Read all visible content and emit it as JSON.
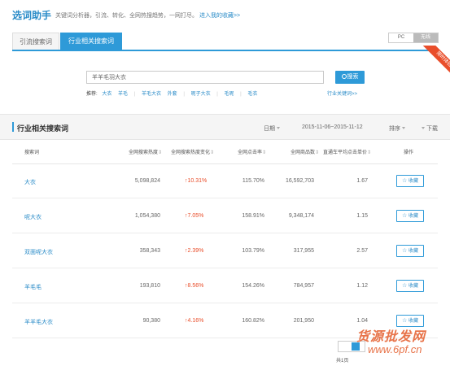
{
  "header": {
    "app_title": "选词助手",
    "description": "关键词分析器，引流、转化、全网热搜趋势，一网打尽。",
    "enter_link": "进入我的收藏>>"
  },
  "tabs": [
    {
      "label": "引流搜索词",
      "active": false
    },
    {
      "label": "行业相关搜索词",
      "active": true
    }
  ],
  "device_toggle": {
    "options": [
      "PC",
      "无线"
    ],
    "selected": "无线"
  },
  "ribbon": {
    "label": "限时体验"
  },
  "search": {
    "value": "羊羊毛羽大衣",
    "button_label": "搜索"
  },
  "recommend": {
    "label": "推荐:",
    "items": [
      "大衣",
      "羊毛",
      "羊毛大衣",
      "外套",
      "呢子大衣",
      "毛呢",
      "毛衣"
    ],
    "industry_link": "行业关键词>>"
  },
  "section": {
    "title": "行业相关搜索词",
    "date_label": "日期",
    "date_range": "2015-11-06~2015-11-12",
    "sort_label": "排序",
    "download_label": "下载"
  },
  "table": {
    "headers": [
      "搜索词",
      "全网搜索热度",
      "全网搜索热度变化",
      "全网点击率",
      "全网商品数",
      "直通车平均点击单价",
      "操作"
    ],
    "rows": [
      {
        "word": "大衣",
        "heat": "5,098,824",
        "change": "↑10.31%",
        "ctr": "115.70%",
        "goods": "16,592,703",
        "cpc": "1.67",
        "action": "收藏"
      },
      {
        "word": "呢大衣",
        "heat": "1,054,380",
        "change": "↑7.05%",
        "ctr": "158.91%",
        "goods": "9,348,174",
        "cpc": "1.15",
        "action": "收藏"
      },
      {
        "word": "双面呢大衣",
        "heat": "358,343",
        "change": "↑2.39%",
        "ctr": "103.79%",
        "goods": "317,955",
        "cpc": "2.57",
        "action": "收藏"
      },
      {
        "word": "羊毛毛",
        "heat": "193,810",
        "change": "↑8.56%",
        "ctr": "154.26%",
        "goods": "784,957",
        "cpc": "1.12",
        "action": "收藏"
      },
      {
        "word": "羊羊毛大衣",
        "heat": "90,380",
        "change": "↑4.16%",
        "ctr": "160.82%",
        "goods": "201,950",
        "cpc": "1.04",
        "action": "收藏"
      }
    ]
  },
  "pagination": {
    "current": "1",
    "total_label": "共1页"
  },
  "watermark": {
    "text": "货源批发网",
    "url": "www.6pf.cn"
  },
  "colors": {
    "accent": "#2e9ad8",
    "ribbon": "#e94e2b",
    "up": "#e94e2b"
  }
}
